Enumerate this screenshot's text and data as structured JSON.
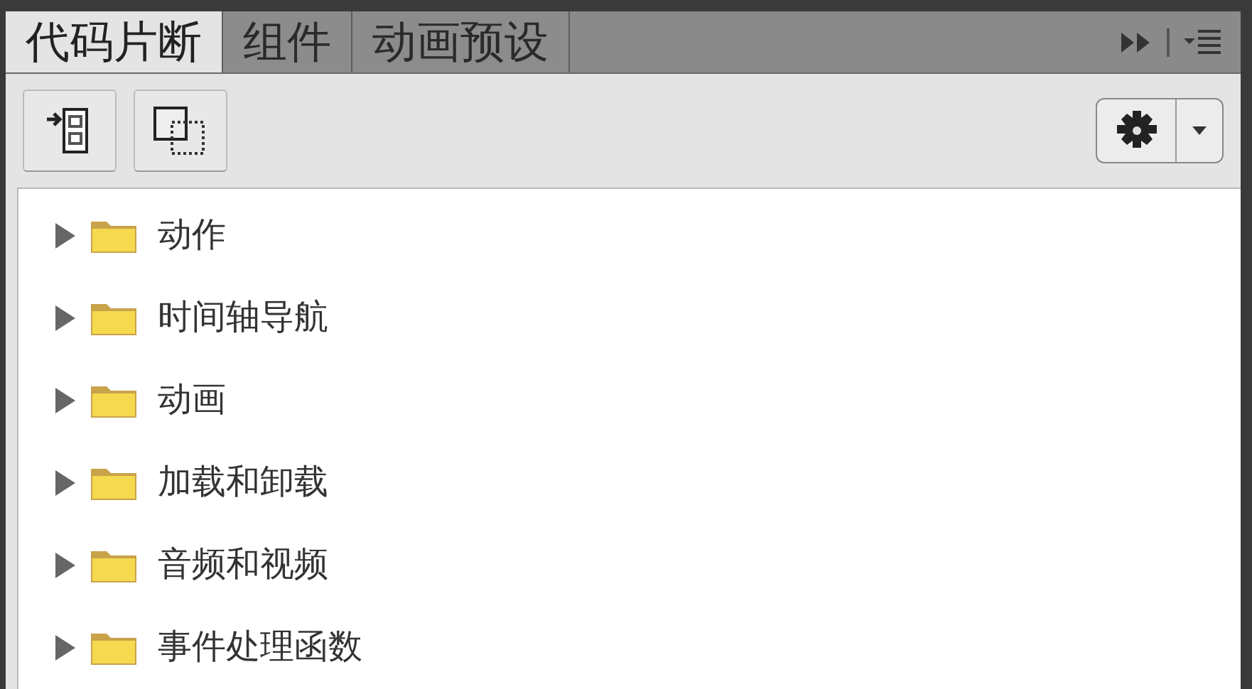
{
  "tabs": [
    {
      "label": "代码片断",
      "selected": true
    },
    {
      "label": "组件",
      "selected": false
    },
    {
      "label": "动画预设",
      "selected": false
    }
  ],
  "tree": {
    "items": [
      {
        "label": "动作",
        "expanded": false
      },
      {
        "label": "时间轴导航",
        "expanded": false
      },
      {
        "label": "动画",
        "expanded": false
      },
      {
        "label": "加载和卸载",
        "expanded": false
      },
      {
        "label": "音频和视频",
        "expanded": false
      },
      {
        "label": "事件处理函数",
        "expanded": false
      }
    ]
  }
}
